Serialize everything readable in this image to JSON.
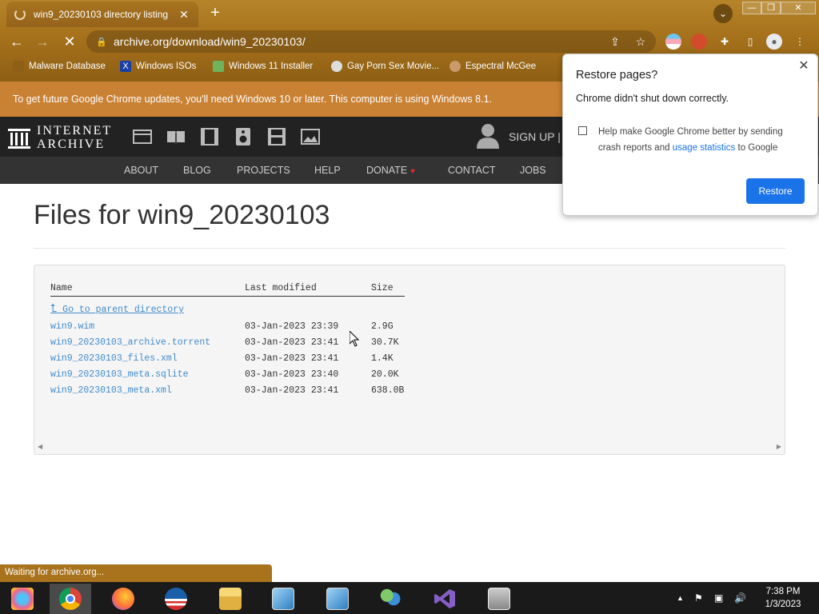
{
  "browser": {
    "tab_title": "win9_20230103 directory listing",
    "tab_close": "✕",
    "new_tab": "+",
    "url": "archive.org/download/win9_20230103/",
    "window_controls": [
      "—",
      "❐",
      "✕"
    ],
    "bookmarks": [
      {
        "label": "Malware Database",
        "icon": "folder-icon"
      },
      {
        "label": "Windows ISOs",
        "icon": "x-icon"
      },
      {
        "label": "Windows 11 Installer",
        "icon": "image-icon"
      },
      {
        "label": "Gay Porn Sex Movie...",
        "icon": "cd-icon"
      },
      {
        "label": "Espectral McGee",
        "icon": "face-icon"
      }
    ],
    "info_bar": "To get future Google Chrome updates, you'll need Windows 10 or later. This computer is using Windows 8.1.",
    "status": "Waiting for archive.org..."
  },
  "archive": {
    "logo_line1": "INTERNET",
    "logo_line2": "ARCHIVE",
    "sign_up": "SIGN UP |",
    "nav": [
      "ABOUT",
      "BLOG",
      "PROJECTS",
      "HELP",
      "DONATE",
      "CONTACT",
      "JOBS"
    ],
    "media_icons": [
      "web-icon",
      "texts-icon",
      "video-icon",
      "audio-icon",
      "software-icon",
      "images-icon"
    ]
  },
  "page": {
    "title": "Files for win9_20230103",
    "columns": [
      "Name",
      "Last modified",
      "Size"
    ],
    "parent_link": " Go to parent directory",
    "files": [
      {
        "name": "win9.wim",
        "modified": "03-Jan-2023 23:39",
        "size": "2.9G"
      },
      {
        "name": "win9_20230103_archive.torrent",
        "modified": "03-Jan-2023 23:41",
        "size": "30.7K"
      },
      {
        "name": "win9_20230103_files.xml",
        "modified": "03-Jan-2023 23:41",
        "size": "1.4K"
      },
      {
        "name": "win9_20230103_meta.sqlite",
        "modified": "03-Jan-2023 23:40",
        "size": "20.0K"
      },
      {
        "name": "win9_20230103_meta.xml",
        "modified": "03-Jan-2023 23:41",
        "size": "638.0B"
      }
    ]
  },
  "popup": {
    "title": "Restore pages?",
    "message": "Chrome didn't shut down correctly.",
    "checkbox_prefix": "Help make Google Chrome better by sending crash reports and ",
    "checkbox_link": "usage statistics",
    "checkbox_suffix": " to Google",
    "button": "Restore"
  },
  "taskbar": {
    "time": "7:38 PM",
    "date": "1/3/2023"
  },
  "colors": {
    "link": "#428bca",
    "chrome_blue": "#1a73e8",
    "info_bar": "#c98133",
    "ia_header": "#222222"
  }
}
